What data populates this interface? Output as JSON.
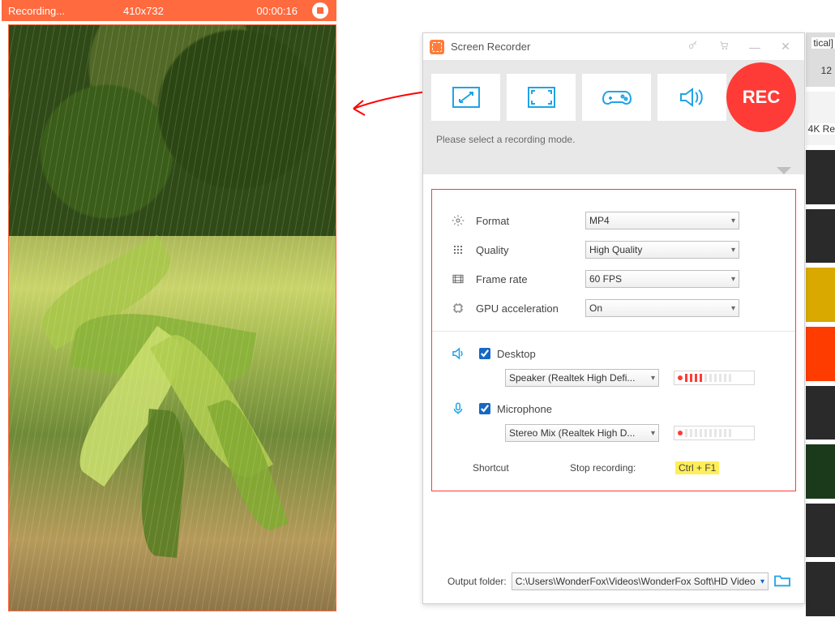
{
  "recbar": {
    "status": "Recording...",
    "dimensions": "410x732",
    "elapsed": "00:00:16"
  },
  "panel": {
    "title": "Screen Recorder",
    "hint": "Please select a recording mode.",
    "rec_label": "REC",
    "settings": {
      "format": {
        "label": "Format",
        "value": "MP4"
      },
      "quality": {
        "label": "Quality",
        "value": "High Quality"
      },
      "fps": {
        "label": "Frame rate",
        "value": "60 FPS"
      },
      "gpu": {
        "label": "GPU acceleration",
        "value": "On"
      }
    },
    "audio": {
      "desktop": {
        "label": "Desktop",
        "checked": true,
        "device": "Speaker (Realtek High Defi..."
      },
      "mic": {
        "label": "Microphone",
        "checked": true,
        "device": "Stereo Mix (Realtek High D..."
      }
    },
    "shortcut": {
      "label": "Shortcut",
      "action": "Stop recording:",
      "key": "Ctrl + F1"
    },
    "output": {
      "label": "Output folder:",
      "path": "C:\\Users\\WonderFox\\Videos\\WonderFox Soft\\HD Video"
    }
  },
  "bg": {
    "tag1": "tical]",
    "tag2": "12",
    "tag3": "4K Re"
  }
}
